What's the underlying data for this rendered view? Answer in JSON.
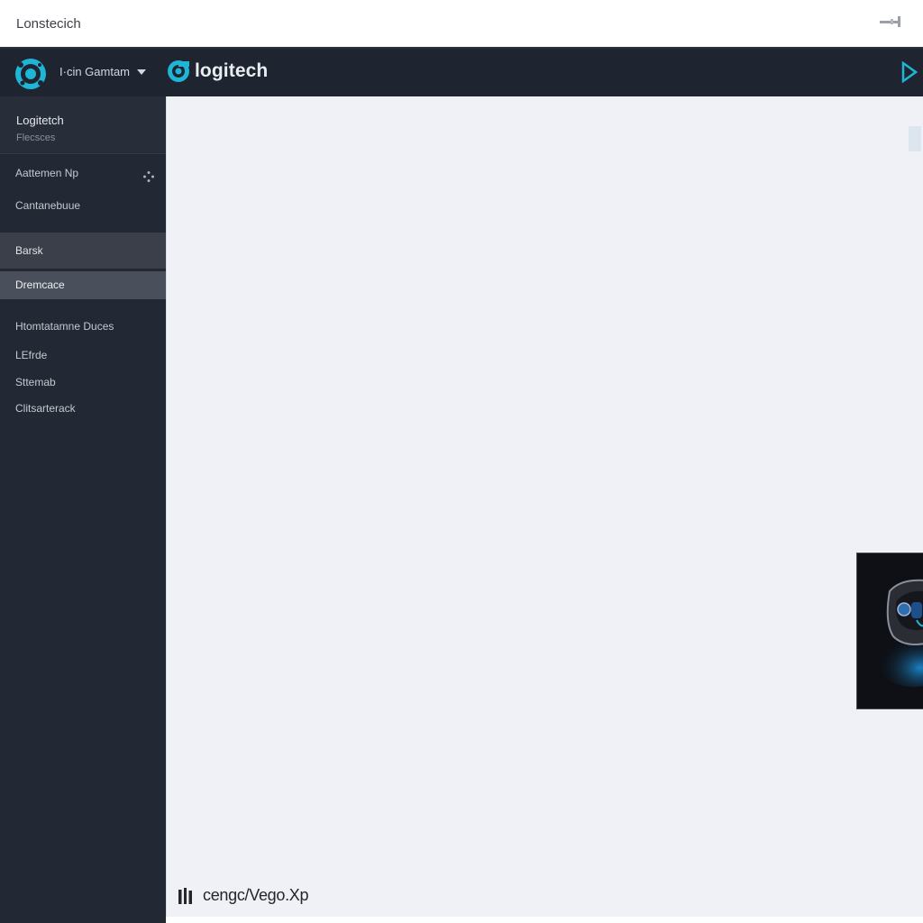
{
  "window": {
    "title": "Lonstecich",
    "control_icon": "window-control-icon"
  },
  "topbar": {
    "app_icon": "logitech-g-hub-icon",
    "profile_label": "I·cin Gamtam",
    "brand_name": "logitech",
    "brand_icon": "logitech-logo-icon",
    "accent_color": "#1eb5d6",
    "play_icon": "play-arrow-icon"
  },
  "sidebar": {
    "header_title": "Logitetch",
    "header_subtitle": "Flecsces",
    "items": [
      {
        "label": "Aattemen Np",
        "icon": "dots-icon"
      },
      {
        "label": "Cantanebuue"
      },
      {
        "label": "Barsk"
      },
      {
        "label": "Dremcace"
      },
      {
        "label": "Htomtatamne Duces"
      },
      {
        "label": "LEfrde"
      },
      {
        "label": "Sttemab"
      },
      {
        "label": "Clitsarterack"
      }
    ]
  },
  "content": {
    "background_color": "#eff1f7",
    "device_image": "gaming-mouse-thumbnail",
    "footer_icon": "bars-icon",
    "footer_text": "cengc/Vego.Xp"
  }
}
